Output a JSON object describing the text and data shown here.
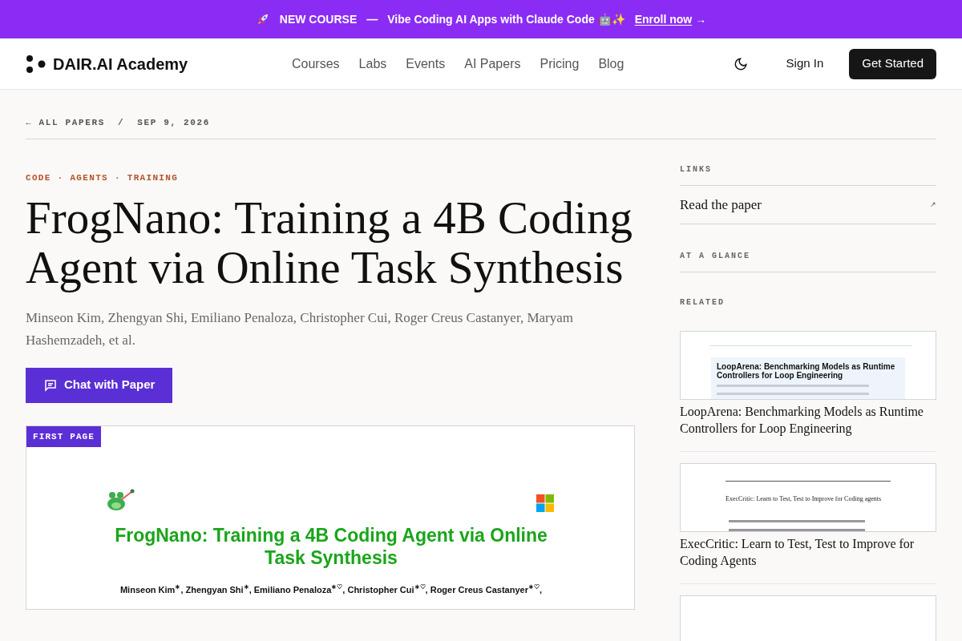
{
  "banner": {
    "label": "NEW COURSE",
    "dash": "—",
    "text": "Vibe Coding AI Apps with Claude Code 🤖✨",
    "link": "Enroll now",
    "arrow": "→"
  },
  "nav": {
    "brand": "DAIR.AI Academy",
    "links": [
      {
        "label": "Courses",
        "selected": false
      },
      {
        "label": "Labs",
        "selected": false
      },
      {
        "label": "Events",
        "selected": false
      },
      {
        "label": "AI Papers",
        "selected": false
      },
      {
        "label": "Pricing",
        "selected": false
      },
      {
        "label": "Blog",
        "selected": false
      }
    ],
    "sign_in": "Sign In",
    "cta": "Get Started"
  },
  "breadcrumb": {
    "back": "← ALL PAPERS",
    "separator": "/",
    "date": "SEP 9, 2026"
  },
  "paper": {
    "tags": "CODE · AGENTS · TRAINING",
    "title": "FrogNano: Training a 4B Coding Agent via Online Task Synthesis",
    "authors": "Minseon Kim, Zhengyan Shi, Emiliano Penaloza, Christopher Cui, Roger Creus Castanyer, Maryam Hashemzadeh, et al.",
    "chat_button": "Chat with Paper",
    "preview": {
      "badge": "FIRST PAGE",
      "title": "FrogNano: Training a 4B Coding Agent via Online Task Synthesis",
      "authors": "Minseon Kim$^{∗}$, Zhengyan Shi$^{∗}$, Emiliano Penaloza$^{∗♡}$, Christopher Cui$^{∗♡}$, Roger Creus Castanyer$^{∗♡}$,"
    }
  },
  "sidebar": {
    "links_heading": "LINKS",
    "links": [
      {
        "label": "Read the paper",
        "arrow": "↗"
      }
    ],
    "glance_heading": "AT A GLANCE",
    "related_heading": "RELATED",
    "related": [
      {
        "kind": "blue",
        "thumb_title": "LoopArena: Benchmarking Models as Runtime Controllers for Loop Engineering",
        "title": "LoopArena: Benchmarking Models as Runtime Controllers for Loop Engineering"
      },
      {
        "kind": "plain",
        "thumb_title": "ExecCritic: Learn to Test, Test to Improve for Coding agents",
        "title": "ExecCritic: Learn to Test, Test to Improve for Coding Agents"
      },
      {
        "kind": "empty"
      }
    ]
  }
}
